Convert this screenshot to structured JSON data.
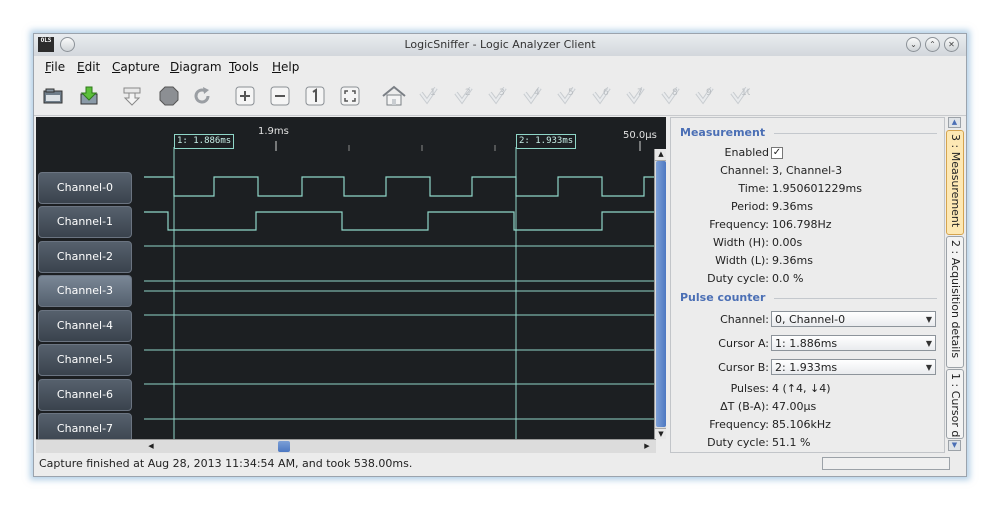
{
  "window": {
    "title": "LogicSniffer - Logic Analyzer Client",
    "logo_text": "OLS"
  },
  "menu": [
    {
      "key": "F",
      "rest": "ile"
    },
    {
      "key": "E",
      "rest": "dit"
    },
    {
      "key": "C",
      "rest": "apture"
    },
    {
      "key": "D",
      "rest": "iagram"
    },
    {
      "key": "T",
      "rest": "ools"
    },
    {
      "key": "H",
      "rest": "elp"
    }
  ],
  "toolbar": {
    "icons": [
      "open-file-icon",
      "save-file-icon",
      "capture-icon",
      "stop-icon",
      "repeat-capture-icon",
      "zoom-in-icon",
      "zoom-out-icon",
      "zoom-original-icon",
      "zoom-fit-icon",
      "home-icon",
      "goto-cursor-1-icon",
      "goto-cursor-2-icon",
      "goto-cursor-3-icon",
      "goto-cursor-4-icon",
      "goto-cursor-5-icon",
      "goto-cursor-6-icon",
      "goto-cursor-7-icon",
      "goto-cursor-8-icon",
      "goto-cursor-9-icon",
      "goto-cursor-10-icon"
    ],
    "cursor_numbers": [
      "1",
      "2",
      "3",
      "4",
      "5",
      "6",
      "7",
      "8",
      "9",
      "10"
    ]
  },
  "timeline": {
    "center_time": "1.9ms",
    "right_time": "50.0µs"
  },
  "cursors": {
    "a": "1: 1.886ms",
    "b": "2: 1.933ms"
  },
  "channels": [
    "Channel-0",
    "Channel-1",
    "Channel-2",
    "Channel-3",
    "Channel-4",
    "Channel-5",
    "Channel-6",
    "Channel-7"
  ],
  "selected_channel": "Channel-3",
  "colors": {
    "wave_bg": "#1c1f22",
    "signal": "#8fd6c8",
    "section_title": "#4b6fb5",
    "active_tab": "#fde8b4"
  },
  "measurement": {
    "title": "Measurement",
    "enabled_label": "Enabled",
    "enabled_check": "✓",
    "rows": [
      {
        "label": "Channel:",
        "value": "3, Channel-3"
      },
      {
        "label": "Time:",
        "value": "1.950601229ms"
      },
      {
        "label": "Period:",
        "value": "9.36ms"
      },
      {
        "label": "Frequency:",
        "value": "106.798Hz"
      },
      {
        "label": "Width (H):",
        "value": "0.00s"
      },
      {
        "label": "Width (L):",
        "value": "9.36ms"
      },
      {
        "label": "Duty cycle:",
        "value": "0.0 %"
      }
    ]
  },
  "pulse_counter": {
    "title": "Pulse counter",
    "channel_label": "Channel:",
    "channel_value": "0, Channel-0",
    "cursor_a_label": "Cursor A:",
    "cursor_a_value": "1: 1.886ms",
    "cursor_b_label": "Cursor B:",
    "cursor_b_value": "2: 1.933ms",
    "rows": [
      {
        "label": "Pulses:",
        "value": "4 (↑4, ↓4)"
      },
      {
        "label": "ΔT (B-A):",
        "value": "47.00µs"
      },
      {
        "label": "Frequency:",
        "value": "85.106kHz"
      },
      {
        "label": "Duty cycle:",
        "value": "51.1 %"
      }
    ]
  },
  "tabs": [
    "3 : Measurement",
    "2 : Acquisition details",
    "1 : Cursor d"
  ],
  "status": "Capture finished at Aug 28, 2013 11:34:54 AM, and took 538.00ms."
}
